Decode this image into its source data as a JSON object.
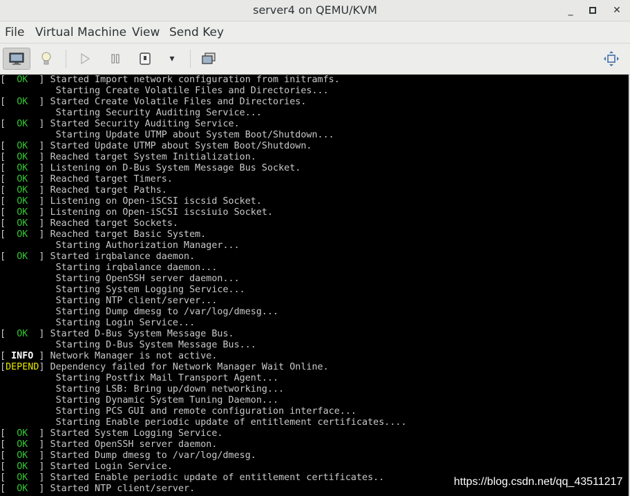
{
  "window": {
    "title": "server4 on QEMU/KVM",
    "minimize_glyph": "_",
    "maximize_glyph": "▫",
    "close_glyph": "✕"
  },
  "menu": [
    "File",
    "Virtual Machine",
    "View",
    "Send Key"
  ],
  "toolbar": {
    "buttons": [
      "monitor-icon",
      "lightbulb-icon",
      "play-icon",
      "pause-icon",
      "power-icon",
      "dropdown-arrow-icon",
      "snapshots-icon",
      "fullscreen-icon"
    ],
    "dropdown_glyph": "▾"
  },
  "colors": {
    "ok": "#33c633",
    "depend": "#e8e800",
    "info": "#ffffff",
    "console_bg": "#000000"
  },
  "console": {
    "lines": [
      {
        "status": "OK",
        "text": "Started Import network configuration from initramfs."
      },
      {
        "status": "",
        "text": "Starting Create Volatile Files and Directories..."
      },
      {
        "status": "OK",
        "text": "Started Create Volatile Files and Directories."
      },
      {
        "status": "",
        "text": "Starting Security Auditing Service..."
      },
      {
        "status": "OK",
        "text": "Started Security Auditing Service."
      },
      {
        "status": "",
        "text": "Starting Update UTMP about System Boot/Shutdown..."
      },
      {
        "status": "OK",
        "text": "Started Update UTMP about System Boot/Shutdown."
      },
      {
        "status": "OK",
        "text": "Reached target System Initialization."
      },
      {
        "status": "OK",
        "text": "Listening on D-Bus System Message Bus Socket."
      },
      {
        "status": "OK",
        "text": "Reached target Timers."
      },
      {
        "status": "OK",
        "text": "Reached target Paths."
      },
      {
        "status": "OK",
        "text": "Listening on Open-iSCSI iscsid Socket."
      },
      {
        "status": "OK",
        "text": "Listening on Open-iSCSI iscsiuio Socket."
      },
      {
        "status": "OK",
        "text": "Reached target Sockets."
      },
      {
        "status": "OK",
        "text": "Reached target Basic System."
      },
      {
        "status": "",
        "text": "Starting Authorization Manager..."
      },
      {
        "status": "OK",
        "text": "Started irqbalance daemon."
      },
      {
        "status": "",
        "text": "Starting irqbalance daemon..."
      },
      {
        "status": "",
        "text": "Starting OpenSSH server daemon..."
      },
      {
        "status": "",
        "text": "Starting System Logging Service..."
      },
      {
        "status": "",
        "text": "Starting NTP client/server..."
      },
      {
        "status": "",
        "text": "Starting Dump dmesg to /var/log/dmesg..."
      },
      {
        "status": "",
        "text": "Starting Login Service..."
      },
      {
        "status": "OK",
        "text": "Started D-Bus System Message Bus."
      },
      {
        "status": "",
        "text": "Starting D-Bus System Message Bus..."
      },
      {
        "status": "INFO",
        "text": "Network Manager is not active."
      },
      {
        "status": "DEPEND",
        "text": "Dependency failed for Network Manager Wait Online."
      },
      {
        "status": "",
        "text": "Starting Postfix Mail Transport Agent..."
      },
      {
        "status": "",
        "text": "Starting LSB: Bring up/down networking..."
      },
      {
        "status": "",
        "text": "Starting Dynamic System Tuning Daemon..."
      },
      {
        "status": "",
        "text": "Starting PCS GUI and remote configuration interface..."
      },
      {
        "status": "",
        "text": "Starting Enable periodic update of entitlement certificates...."
      },
      {
        "status": "OK",
        "text": "Started System Logging Service."
      },
      {
        "status": "OK",
        "text": "Started OpenSSH server daemon."
      },
      {
        "status": "OK",
        "text": "Started Dump dmesg to /var/log/dmesg."
      },
      {
        "status": "OK",
        "text": "Started Login Service."
      },
      {
        "status": "OK",
        "text": "Started Enable periodic update of entitlement certificates.."
      },
      {
        "status": "OK",
        "text": "Started NTP client/server."
      }
    ]
  },
  "watermark": "https://blog.csdn.net/qq_43511217"
}
